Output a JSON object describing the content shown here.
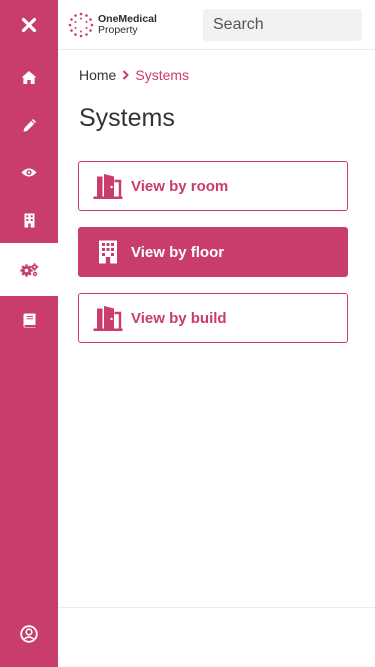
{
  "brand": {
    "line1": "OneMedical",
    "line2": "Property",
    "accent_color": "#c83d6a"
  },
  "search": {
    "placeholder": "Search",
    "value": ""
  },
  "sidebar": {
    "items": [
      {
        "icon": "close-icon",
        "active": false
      },
      {
        "icon": "home-icon",
        "active": false
      },
      {
        "icon": "pencil-icon",
        "active": false
      },
      {
        "icon": "eye-icon",
        "active": false
      },
      {
        "icon": "building-icon",
        "active": false
      },
      {
        "icon": "gears-icon",
        "active": true
      },
      {
        "icon": "book-icon",
        "active": false
      },
      {
        "icon": "user-circle-icon",
        "active": false
      }
    ]
  },
  "breadcrumb": {
    "home": "Home",
    "current": "Systems"
  },
  "page": {
    "title": "Systems"
  },
  "options": [
    {
      "label": "View by room",
      "icon": "door-icon",
      "selected": false
    },
    {
      "label": "View by floor",
      "icon": "building-icon",
      "selected": true
    },
    {
      "label": "View by build",
      "icon": "door-icon",
      "selected": false
    }
  ]
}
